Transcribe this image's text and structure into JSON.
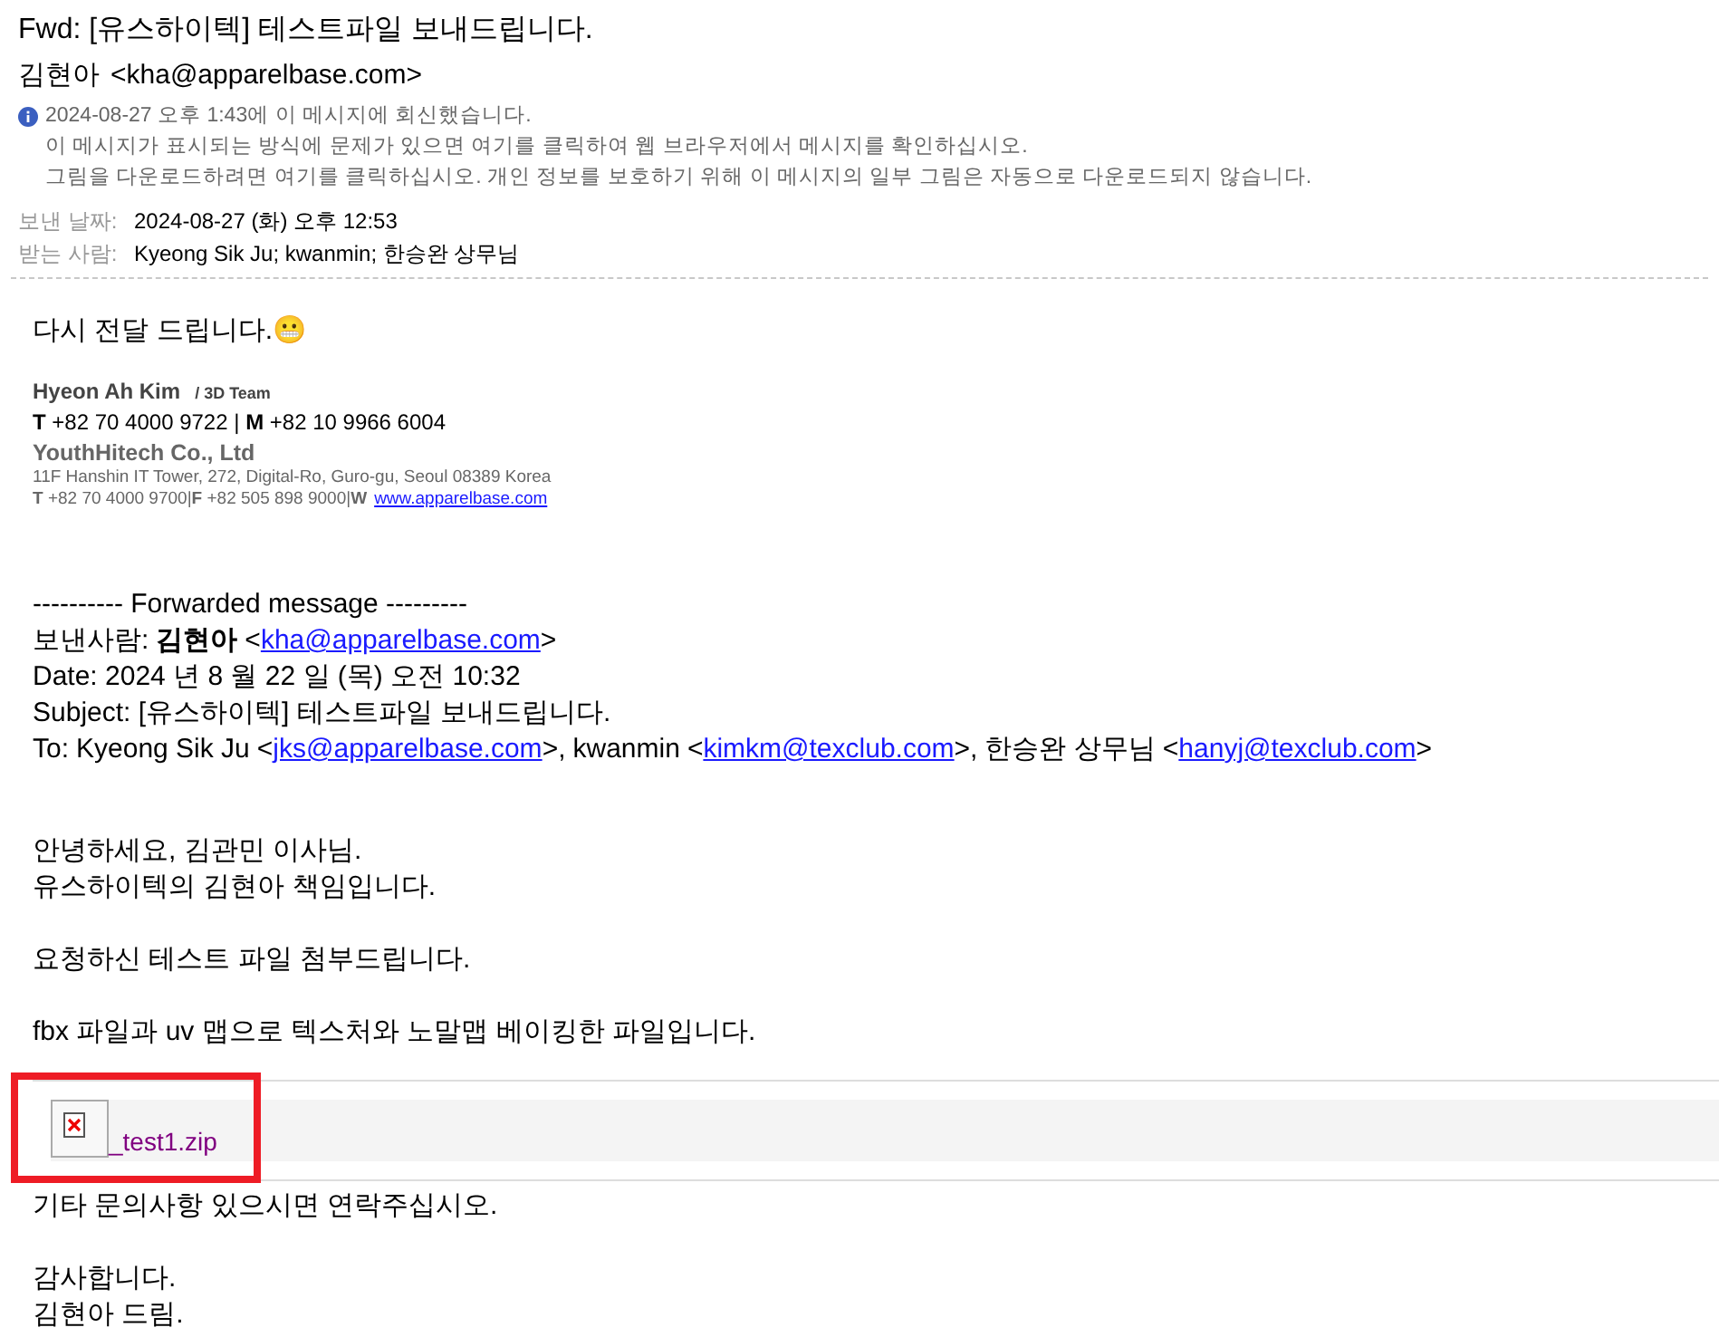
{
  "subject": "Fwd: [유스하이텍] 테스트파일 보내드립니다.",
  "sender": {
    "name": "김현아",
    "email": "<kha@apparelbase.com>"
  },
  "info_lines": [
    "2024-08-27 오후 1:43에 이 메시지에 회신했습니다.",
    "이 메시지가 표시되는 방식에 문제가 있으면 여기를 클릭하여 웹 브라우저에서 메시지를 확인하십시오.",
    "그림을 다운로드하려면 여기를 클릭하십시오. 개인 정보를 보호하기 위해 이 메시지의 일부 그림은 자동으로 다운로드되지 않습니다."
  ],
  "fields": [
    {
      "label": "보낸 날짜:",
      "value": "2024-08-27 (화) 오후 12:53"
    },
    {
      "label": "받는 사람:",
      "value": "Kyeong Sik Ju; kwanmin; 한승완 상무님"
    }
  ],
  "intro": "다시 전달 드립니다.😬",
  "signature": {
    "name": "Hyeon Ah Kim",
    "team": "/ 3D Team",
    "phones": "**T** +82 70 4000 9722 | **M** +82 10 9966 6004",
    "company": "YouthHitech Co., Ltd",
    "address": "11F Hanshin IT Tower, 272, Digital-Ro, Guro-gu, Seoul 08389 Korea",
    "contact": "**T** +82 70 4000 9700|**F** +82 505 898 9000|**W**",
    "website": "www.apparelbase.com"
  },
  "forwarded": {
    "divider": "---------- Forwarded message ---------",
    "from_label": "보낸사람:",
    "from_name": "김현아",
    "from_open": "<",
    "from_email": "kha@apparelbase.com",
    "from_close": ">",
    "date": "Date: 2024 년 8 월 22 일 (목) 오전 10:32",
    "subject": "Subject: [유스하이텍] 테스트파일 보내드립니다.",
    "to_label": "To:",
    "recipients": [
      {
        "name": "Kyeong Sik Ju",
        "open": "<",
        "email": "jks@apparelbase.com",
        "close": ">,"
      },
      {
        "name": "kwanmin",
        "open": "<",
        "email": "kimkm@texclub.com",
        "close": ">,"
      },
      {
        "name": "한승완 상무님",
        "open": "<",
        "email": "hanyj@texclub.com",
        "close": ">"
      }
    ]
  },
  "body_paragraphs": [
    [
      "안녕하세요, 김관민 이사님.",
      "유스하이텍의 김현아 책임입니다."
    ],
    [
      "요청하신 테스트 파일 첨부드립니다."
    ],
    [
      "fbx 파일과 uv 맵으로 텍스처와 노말맵 베이킹한 파일입니다."
    ]
  ],
  "attachment": {
    "filename": "_test1.zip",
    "highlighted": true
  },
  "closing_paragraphs": [
    [
      "기타 문의사항 있으시면 연락주십시오."
    ],
    [
      "감사합니다.",
      "김현아 드림."
    ]
  ]
}
